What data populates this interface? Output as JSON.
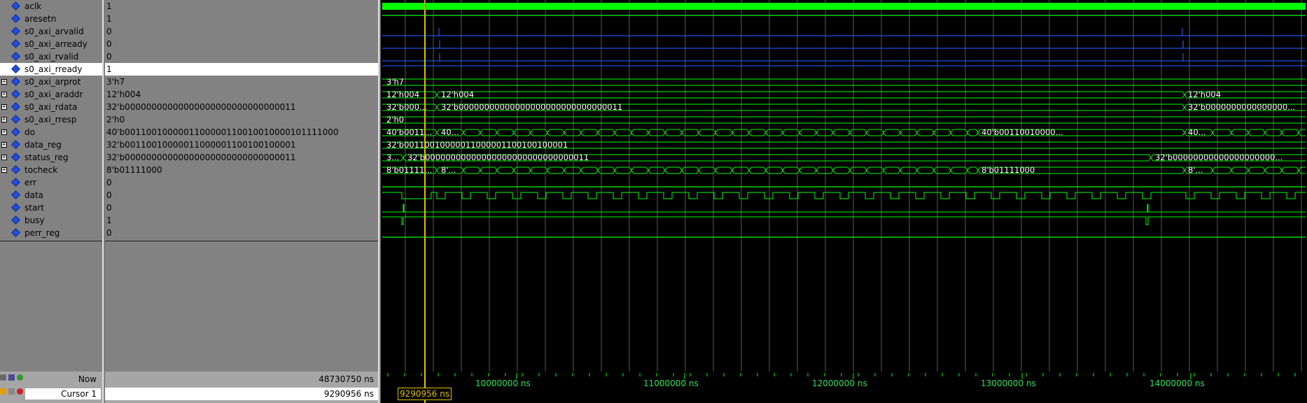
{
  "signals": [
    {
      "name": "aclk",
      "value": "1",
      "bus": false
    },
    {
      "name": "aresetn",
      "value": "1",
      "bus": false
    },
    {
      "name": "s0_axi_arvalid",
      "value": "0",
      "bus": false
    },
    {
      "name": "s0_axi_arready",
      "value": "0",
      "bus": false
    },
    {
      "name": "s0_axi_rvalid",
      "value": "0",
      "bus": false
    },
    {
      "name": "s0_axi_rready",
      "value": "1",
      "bus": false,
      "selected": true
    },
    {
      "name": "s0_axi_arprot",
      "value": "3'h7",
      "bus": true
    },
    {
      "name": "s0_axi_araddr",
      "value": "12'h004",
      "bus": true
    },
    {
      "name": "s0_axi_rdata",
      "value": "32'b00000000000000000000000000000011",
      "bus": true
    },
    {
      "name": "s0_axi_rresp",
      "value": "2'h0",
      "bus": true
    },
    {
      "name": "do",
      "value": "40'b0011001000001100000110010010000101111000",
      "bus": true
    },
    {
      "name": "data_reg",
      "value": "32'b00110010000011000001100100100001",
      "bus": true
    },
    {
      "name": "status_reg",
      "value": "32'b00000000000000000000000000000011",
      "bus": true
    },
    {
      "name": "tocheck",
      "value": "8'b01111000",
      "bus": true
    },
    {
      "name": "err",
      "value": "0",
      "bus": false
    },
    {
      "name": "data",
      "value": "0",
      "bus": false
    },
    {
      "name": "start",
      "value": "0",
      "bus": false
    },
    {
      "name": "busy",
      "value": "1",
      "bus": false
    },
    {
      "name": "perr_reg",
      "value": "0",
      "bus": false
    }
  ],
  "wave_labels": {
    "arprot": [
      "3'h7"
    ],
    "araddr": [
      "12'h004",
      "12'h004",
      "12'h004"
    ],
    "rdata": [
      "32'b000...",
      "32'b00000000000000000000000000000011",
      "32'b0000000000000000..."
    ],
    "rresp": [
      "2'h0"
    ],
    "do": [
      "40'b0011...",
      "40...",
      "40'b00110010000...",
      "40..."
    ],
    "data_reg": [
      "32'b00110010000011000001100100100001"
    ],
    "status_reg": [
      "3...",
      "32'b00000000000000000000000000000011",
      "32'b00000000000000000000..."
    ],
    "tocheck": [
      "8'b01111...",
      "8'...",
      "8'b01111000",
      "8'..."
    ]
  },
  "footer": {
    "now_label": "Now",
    "now_value": "48730750 ns",
    "cursor_label": "Cursor 1",
    "cursor_value": "9290956 ns",
    "cursor_flag": "9290956 ns"
  },
  "axis_ticks": [
    "10000000 ns",
    "11000000 ns",
    "12000000 ns",
    "13000000 ns",
    "14000000 ns"
  ],
  "colors": {
    "wave": "#00ff00",
    "cursor": "#e0c000",
    "grid": "#5a5a5a",
    "sel": "#ffffff"
  }
}
